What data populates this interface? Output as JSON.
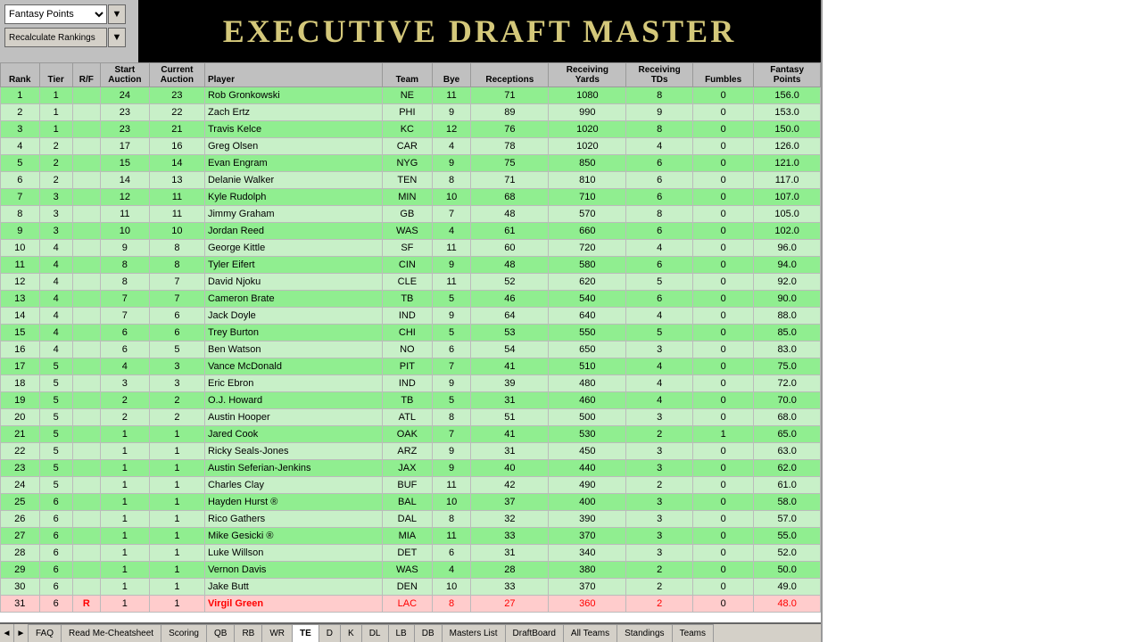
{
  "app": {
    "title": "EXECUTIVE DRAFT MASTER"
  },
  "controls": {
    "dropdown_value": "Fantasy Points",
    "recalc_label": "Recalculate Rankings"
  },
  "columns": {
    "rank": "Rank",
    "tier": "Tier",
    "rf": "R/F",
    "start_auction": "Start\nAuction",
    "current_auction": "Current\nAuction",
    "player": "Player",
    "team": "Team",
    "bye": "Bye",
    "receptions": "Receptions",
    "receiving_yards": "Receiving\nYards",
    "receiving_tds": "Receiving\nTDs",
    "fumbles": "Fumbles",
    "fantasy_points": "Fantasy\nPoints"
  },
  "rows": [
    {
      "rank": 1,
      "tier": 1,
      "rf": "",
      "start": 24,
      "current": 23,
      "player": "Rob Gronkowski",
      "team": "NE",
      "bye": 11,
      "rec": 71,
      "ryds": 1080,
      "rtds": 8,
      "fum": 0,
      "fp": 156.0,
      "highlight": false,
      "red": false
    },
    {
      "rank": 2,
      "tier": 1,
      "rf": "",
      "start": 23,
      "current": 22,
      "player": "Zach Ertz",
      "team": "PHI",
      "bye": 9,
      "rec": 89,
      "ryds": 990,
      "rtds": 9,
      "fum": 0,
      "fp": 153.0,
      "highlight": false,
      "red": false
    },
    {
      "rank": 3,
      "tier": 1,
      "rf": "",
      "start": 23,
      "current": 21,
      "player": "Travis Kelce",
      "team": "KC",
      "bye": 12,
      "rec": 76,
      "ryds": 1020,
      "rtds": 8,
      "fum": 0,
      "fp": 150.0,
      "highlight": false,
      "red": false
    },
    {
      "rank": 4,
      "tier": 2,
      "rf": "",
      "start": 17,
      "current": 16,
      "player": "Greg Olsen",
      "team": "CAR",
      "bye": 4,
      "rec": 78,
      "ryds": 1020,
      "rtds": 4,
      "fum": 0,
      "fp": 126.0,
      "highlight": false,
      "red": false
    },
    {
      "rank": 5,
      "tier": 2,
      "rf": "",
      "start": 15,
      "current": 14,
      "player": "Evan Engram",
      "team": "NYG",
      "bye": 9,
      "rec": 75,
      "ryds": 850,
      "rtds": 6,
      "fum": 0,
      "fp": 121.0,
      "highlight": false,
      "red": false
    },
    {
      "rank": 6,
      "tier": 2,
      "rf": "",
      "start": 14,
      "current": 13,
      "player": "Delanie Walker",
      "team": "TEN",
      "bye": 8,
      "rec": 71,
      "ryds": 810,
      "rtds": 6,
      "fum": 0,
      "fp": 117.0,
      "highlight": false,
      "red": false
    },
    {
      "rank": 7,
      "tier": 3,
      "rf": "",
      "start": 12,
      "current": 11,
      "player": "Kyle Rudolph",
      "team": "MIN",
      "bye": 10,
      "rec": 68,
      "ryds": 710,
      "rtds": 6,
      "fum": 0,
      "fp": 107.0,
      "highlight": false,
      "red": false
    },
    {
      "rank": 8,
      "tier": 3,
      "rf": "",
      "start": 11,
      "current": 11,
      "player": "Jimmy Graham",
      "team": "GB",
      "bye": 7,
      "rec": 48,
      "ryds": 570,
      "rtds": 8,
      "fum": 0,
      "fp": 105.0,
      "highlight": false,
      "red": false
    },
    {
      "rank": 9,
      "tier": 3,
      "rf": "",
      "start": 10,
      "current": 10,
      "player": "Jordan Reed",
      "team": "WAS",
      "bye": 4,
      "rec": 61,
      "ryds": 660,
      "rtds": 6,
      "fum": 0,
      "fp": 102.0,
      "highlight": false,
      "red": false
    },
    {
      "rank": 10,
      "tier": 4,
      "rf": "",
      "start": 9,
      "current": 8,
      "player": "George Kittle",
      "team": "SF",
      "bye": 11,
      "rec": 60,
      "ryds": 720,
      "rtds": 4,
      "fum": 0,
      "fp": 96.0,
      "highlight": false,
      "red": false
    },
    {
      "rank": 11,
      "tier": 4,
      "rf": "",
      "start": 8,
      "current": 8,
      "player": "Tyler Eifert",
      "team": "CIN",
      "bye": 9,
      "rec": 48,
      "ryds": 580,
      "rtds": 6,
      "fum": 0,
      "fp": 94.0,
      "highlight": false,
      "red": false
    },
    {
      "rank": 12,
      "tier": 4,
      "rf": "",
      "start": 8,
      "current": 7,
      "player": "David Njoku",
      "team": "CLE",
      "bye": 11,
      "rec": 52,
      "ryds": 620,
      "rtds": 5,
      "fum": 0,
      "fp": 92.0,
      "highlight": false,
      "red": false
    },
    {
      "rank": 13,
      "tier": 4,
      "rf": "",
      "start": 7,
      "current": 7,
      "player": "Cameron Brate",
      "team": "TB",
      "bye": 5,
      "rec": 46,
      "ryds": 540,
      "rtds": 6,
      "fum": 0,
      "fp": 90.0,
      "highlight": false,
      "red": false
    },
    {
      "rank": 14,
      "tier": 4,
      "rf": "",
      "start": 7,
      "current": 6,
      "player": "Jack Doyle",
      "team": "IND",
      "bye": 9,
      "rec": 64,
      "ryds": 640,
      "rtds": 4,
      "fum": 0,
      "fp": 88.0,
      "highlight": false,
      "red": false
    },
    {
      "rank": 15,
      "tier": 4,
      "rf": "",
      "start": 6,
      "current": 6,
      "player": "Trey Burton",
      "team": "CHI",
      "bye": 5,
      "rec": 53,
      "ryds": 550,
      "rtds": 5,
      "fum": 0,
      "fp": 85.0,
      "highlight": false,
      "red": false
    },
    {
      "rank": 16,
      "tier": 4,
      "rf": "",
      "start": 6,
      "current": 5,
      "player": "Ben Watson",
      "team": "NO",
      "bye": 6,
      "rec": 54,
      "ryds": 650,
      "rtds": 3,
      "fum": 0,
      "fp": 83.0,
      "highlight": false,
      "red": false
    },
    {
      "rank": 17,
      "tier": 5,
      "rf": "",
      "start": 4,
      "current": 3,
      "player": "Vance McDonald",
      "team": "PIT",
      "bye": 7,
      "rec": 41,
      "ryds": 510,
      "rtds": 4,
      "fum": 0,
      "fp": 75.0,
      "highlight": false,
      "red": false
    },
    {
      "rank": 18,
      "tier": 5,
      "rf": "",
      "start": 3,
      "current": 3,
      "player": "Eric Ebron",
      "team": "IND",
      "bye": 9,
      "rec": 39,
      "ryds": 480,
      "rtds": 4,
      "fum": 0,
      "fp": 72.0,
      "highlight": false,
      "red": false
    },
    {
      "rank": 19,
      "tier": 5,
      "rf": "",
      "start": 2,
      "current": 2,
      "player": "O.J. Howard",
      "team": "TB",
      "bye": 5,
      "rec": 31,
      "ryds": 460,
      "rtds": 4,
      "fum": 0,
      "fp": 70.0,
      "highlight": false,
      "red": false
    },
    {
      "rank": 20,
      "tier": 5,
      "rf": "",
      "start": 2,
      "current": 2,
      "player": "Austin Hooper",
      "team": "ATL",
      "bye": 8,
      "rec": 51,
      "ryds": 500,
      "rtds": 3,
      "fum": 0,
      "fp": 68.0,
      "highlight": false,
      "red": false
    },
    {
      "rank": 21,
      "tier": 5,
      "rf": "",
      "start": 1,
      "current": 1,
      "player": "Jared Cook",
      "team": "OAK",
      "bye": 7,
      "rec": 41,
      "ryds": 530,
      "rtds": 2,
      "fum": 1,
      "fp": 65.0,
      "highlight": false,
      "red": false
    },
    {
      "rank": 22,
      "tier": 5,
      "rf": "",
      "start": 1,
      "current": 1,
      "player": "Ricky Seals-Jones",
      "team": "ARZ",
      "bye": 9,
      "rec": 31,
      "ryds": 450,
      "rtds": 3,
      "fum": 0,
      "fp": 63.0,
      "highlight": false,
      "red": false
    },
    {
      "rank": 23,
      "tier": 5,
      "rf": "",
      "start": 1,
      "current": 1,
      "player": "Austin Seferian-Jenkins",
      "team": "JAX",
      "bye": 9,
      "rec": 40,
      "ryds": 440,
      "rtds": 3,
      "fum": 0,
      "fp": 62.0,
      "highlight": false,
      "red": false
    },
    {
      "rank": 24,
      "tier": 5,
      "rf": "",
      "start": 1,
      "current": 1,
      "player": "Charles Clay",
      "team": "BUF",
      "bye": 11,
      "rec": 42,
      "ryds": 490,
      "rtds": 2,
      "fum": 0,
      "fp": 61.0,
      "highlight": false,
      "red": false
    },
    {
      "rank": 25,
      "tier": 6,
      "rf": "",
      "start": 1,
      "current": 1,
      "player": "Hayden Hurst ®",
      "team": "BAL",
      "bye": 10,
      "rec": 37,
      "ryds": 400,
      "rtds": 3,
      "fum": 0,
      "fp": 58.0,
      "highlight": false,
      "red": false
    },
    {
      "rank": 26,
      "tier": 6,
      "rf": "",
      "start": 1,
      "current": 1,
      "player": "Rico Gathers",
      "team": "DAL",
      "bye": 8,
      "rec": 32,
      "ryds": 390,
      "rtds": 3,
      "fum": 0,
      "fp": 57.0,
      "highlight": false,
      "red": false
    },
    {
      "rank": 27,
      "tier": 6,
      "rf": "",
      "start": 1,
      "current": 1,
      "player": "Mike Gesicki ®",
      "team": "MIA",
      "bye": 11,
      "rec": 33,
      "ryds": 370,
      "rtds": 3,
      "fum": 0,
      "fp": 55.0,
      "highlight": false,
      "red": false
    },
    {
      "rank": 28,
      "tier": 6,
      "rf": "",
      "start": 1,
      "current": 1,
      "player": "Luke Willson",
      "team": "DET",
      "bye": 6,
      "rec": 31,
      "ryds": 340,
      "rtds": 3,
      "fum": 0,
      "fp": 52.0,
      "highlight": false,
      "red": false
    },
    {
      "rank": 29,
      "tier": 6,
      "rf": "",
      "start": 1,
      "current": 1,
      "player": "Vernon Davis",
      "team": "WAS",
      "bye": 4,
      "rec": 28,
      "ryds": 380,
      "rtds": 2,
      "fum": 0,
      "fp": 50.0,
      "highlight": false,
      "red": false
    },
    {
      "rank": 30,
      "tier": 6,
      "rf": "",
      "start": 1,
      "current": 1,
      "player": "Jake Butt",
      "team": "DEN",
      "bye": 10,
      "rec": 33,
      "ryds": 370,
      "rtds": 2,
      "fum": 0,
      "fp": 49.0,
      "highlight": false,
      "red": false
    },
    {
      "rank": 31,
      "tier": 6,
      "rf": "R",
      "start": 1,
      "current": 1,
      "player": "Virgil Green",
      "team": "LAC",
      "bye": 8,
      "rec": 27,
      "ryds": 360,
      "rtds": 2,
      "fum": 0,
      "fp": 48.0,
      "highlight": true,
      "red": true
    }
  ],
  "tabs": [
    {
      "id": "faq",
      "label": "FAQ"
    },
    {
      "id": "read-me",
      "label": "Read Me-Cheatsheet"
    },
    {
      "id": "scoring",
      "label": "Scoring"
    },
    {
      "id": "qb",
      "label": "QB"
    },
    {
      "id": "rb",
      "label": "RB"
    },
    {
      "id": "wr",
      "label": "WR"
    },
    {
      "id": "te",
      "label": "TE",
      "active": true
    },
    {
      "id": "d",
      "label": "D"
    },
    {
      "id": "k",
      "label": "K"
    },
    {
      "id": "dl",
      "label": "DL"
    },
    {
      "id": "lb",
      "label": "LB"
    },
    {
      "id": "db",
      "label": "DB"
    },
    {
      "id": "masters-list",
      "label": "Masters List"
    },
    {
      "id": "draftboard",
      "label": "DraftBoard"
    },
    {
      "id": "all-teams",
      "label": "All Teams"
    },
    {
      "id": "standings",
      "label": "Standings"
    },
    {
      "id": "teams",
      "label": "Teams"
    }
  ]
}
